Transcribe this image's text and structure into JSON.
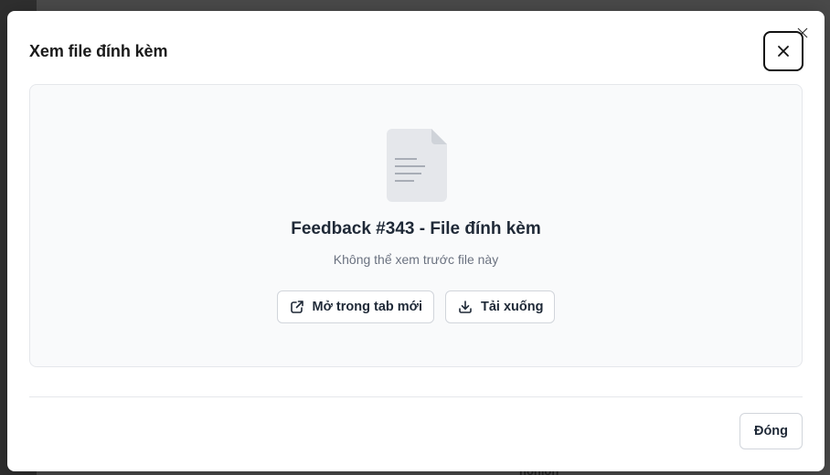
{
  "backdrop": {
    "partial_text": "nohion"
  },
  "dialog": {
    "title": "Xem file đính kèm",
    "close_icon": "close-icon"
  },
  "preview": {
    "file_icon": "document-icon",
    "file_name": "Feedback #343 - File đính kèm",
    "note": "Không thể xem trước file này",
    "open_new_tab": {
      "label": "Mở trong tab mới",
      "icon": "external-link-icon"
    },
    "download": {
      "label": "Tải xuống",
      "icon": "download-icon"
    }
  },
  "footer": {
    "close_label": "Đóng"
  },
  "colors": {
    "panel_bg": "#f9fafb",
    "border": "#e5e7eb",
    "text_primary": "#1f2937",
    "text_muted": "#6b7280",
    "file_icon_fill": "#e5e7eb",
    "file_icon_lines": "#9ca3af"
  }
}
